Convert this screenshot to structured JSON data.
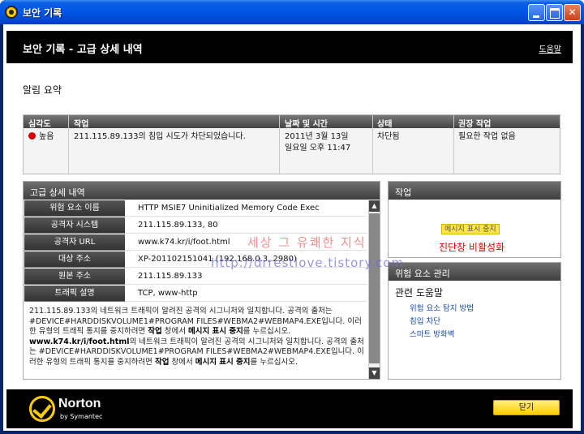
{
  "window": {
    "title": "보안 기록"
  },
  "header": {
    "title": "보안 기록 - 고급 상세 내역",
    "help": "도움말"
  },
  "summary": {
    "title": "알림 요약"
  },
  "alert": {
    "columns": [
      "심각도",
      "작업",
      "날짜 및 시간",
      "상태",
      "권장 작업"
    ],
    "severity": "높음",
    "severity_color": "#d40000",
    "task": "211.115.89.133의 침입 시도가 차단되었습니다.",
    "date_line1": "2011년 3월 13일",
    "date_line2": "일요일 오후 11:47",
    "status": "차단됨",
    "recommended": "필요한 작업 없음"
  },
  "detail": {
    "title": "고급 상세 내역",
    "rows": [
      {
        "key": "위험 요소 이름",
        "value": "HTTP MSIE7 Uninitialized Memory Code Exec"
      },
      {
        "key": "공격자 시스템",
        "value": "211.115.89.133, 80"
      },
      {
        "key": "공격자 URL",
        "value": "www.k74.kr/i/foot.html"
      },
      {
        "key": "대상 주소",
        "value": "XP-201102151041 (192.168.0.3, 2980)"
      },
      {
        "key": "원본 주소",
        "value": "211.115.89.133"
      },
      {
        "key": "트래픽 설명",
        "value": "TCP, www-http"
      }
    ],
    "desc_p1": "211.115.89.133의 네트워크 트래픽이 알려진 공격의 시그니처와 일치합니다. 공격의 출처는 #DEVICE#HARDDISKVOLUME1#PROGRAM FILES#WEBMA2#WEBMAP4.EXE입니다. 이러한 유형의 트래픽 통지를 중지하려면",
    "desc_b1": "작업",
    "desc_p2": "창에서",
    "desc_b2": "메시지 표시 중지",
    "desc_p3": "를 누르십시오.",
    "desc_url": "www.k74.kr/i/foot.html",
    "desc_p4": "의 네트워크 트래픽이 알려진 공격의 시그니처와 일치합니다. 공격의 출처는 #DEVICE#HARDDISKVOLUME1#PROGRAM FILES#WEBMA2#WEBMAP4.EXE입니다. 이러한 유형의 트래픽 통지를 중지하려면",
    "desc_b3": "작업",
    "desc_p5": "창에서",
    "desc_b4": "메시지 표시 중지",
    "desc_p6": "를 누르십시오."
  },
  "action": {
    "title": "작업",
    "stop_button": "메시지 표시 중지",
    "disable_link": "진단창 비활성화"
  },
  "manage": {
    "title": "위험 요소 관리",
    "subtitle": "관련 도움말",
    "links": [
      "위험 요소 탐지 방법",
      "침입 차단",
      "스마트 방화벽"
    ]
  },
  "watermark": {
    "line1": "세상 그 유쾌한 지식",
    "line2": "http://drrestlove.tistory.com"
  },
  "footer": {
    "brand": "Norton",
    "brand_sub": "by Symantec",
    "close_button": "닫기",
    "accent": "#ffcc00"
  }
}
